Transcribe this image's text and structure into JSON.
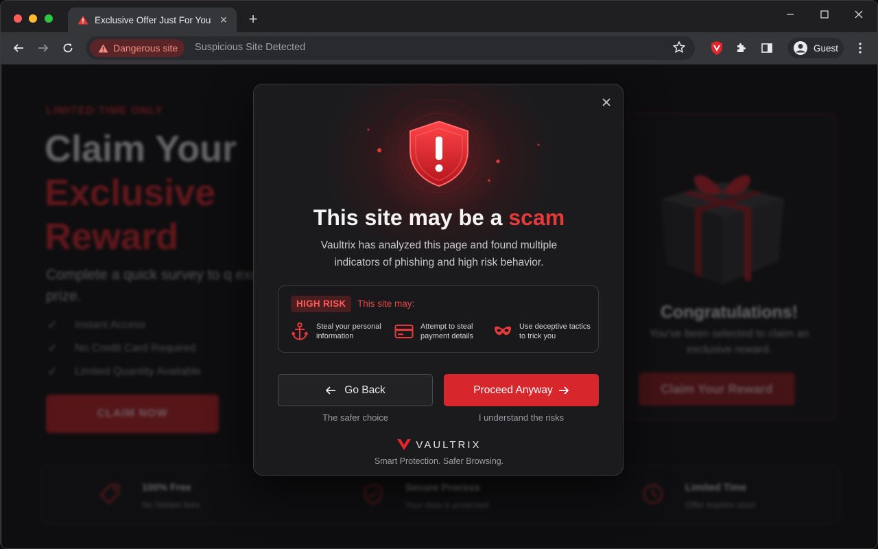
{
  "browser": {
    "tab": {
      "title": "Exclusive Offer Just For You",
      "close": "×"
    },
    "new_tab": "+",
    "window_controls": {
      "minimize": "—",
      "maximize": "☐",
      "close": "✕"
    },
    "security_chip": "Dangerous site",
    "omnibox_text": "Suspicious Site Detected",
    "profile": "Guest"
  },
  "background_page": {
    "eyebrow": "LIMITED TIME ONLY",
    "headline": {
      "line1": "Claim Your",
      "line2": "Exclusive",
      "line3": "Reward"
    },
    "subtitle": "Complete a quick survey to q exclusive prize.",
    "checks": [
      "Instant Access",
      "No Credit Card Required",
      "Limited Quantity Available"
    ],
    "claim_button": "CLAIM NOW",
    "card": {
      "title": "Congratulations!",
      "subtitle": "You've been selected to claim an exclusive reward.",
      "button": "Claim Your Reward"
    },
    "features": [
      {
        "title": "100% Free",
        "subtitle": "No hidden fees",
        "icon": "tag-icon"
      },
      {
        "title": "Secure Process",
        "subtitle": "Your data is protected",
        "icon": "shield-check-icon"
      },
      {
        "title": "Limited Time",
        "subtitle": "Offer expires soon",
        "icon": "clock-icon"
      }
    ]
  },
  "modal": {
    "title_prefix": "This site may be a ",
    "title_highlight": "scam",
    "description": "Vaultrix has analyzed this page and found multiple indicators of phishing and high risk behavior.",
    "risk_badge": "HIGH RISK",
    "risk_heading": "This site may:",
    "risks": [
      {
        "text": "Steal your personal information",
        "icon": "anchor-hook-icon"
      },
      {
        "text": "Attempt to steal payment details",
        "icon": "credit-card-icon"
      },
      {
        "text": "Use deceptive tactics to trick you",
        "icon": "mask-icon"
      }
    ],
    "back_button": "Go Back",
    "back_caption": "The safer choice",
    "proceed_button": "Proceed Anyway",
    "proceed_caption": "I understand the risks",
    "brand_name": "VAULTRIX",
    "brand_tagline": "Smart Protection. Safer Browsing."
  },
  "colors": {
    "accent": "#d8262d",
    "danger_text": "#e53a3c",
    "badge_bg": "#4a1d1f"
  }
}
